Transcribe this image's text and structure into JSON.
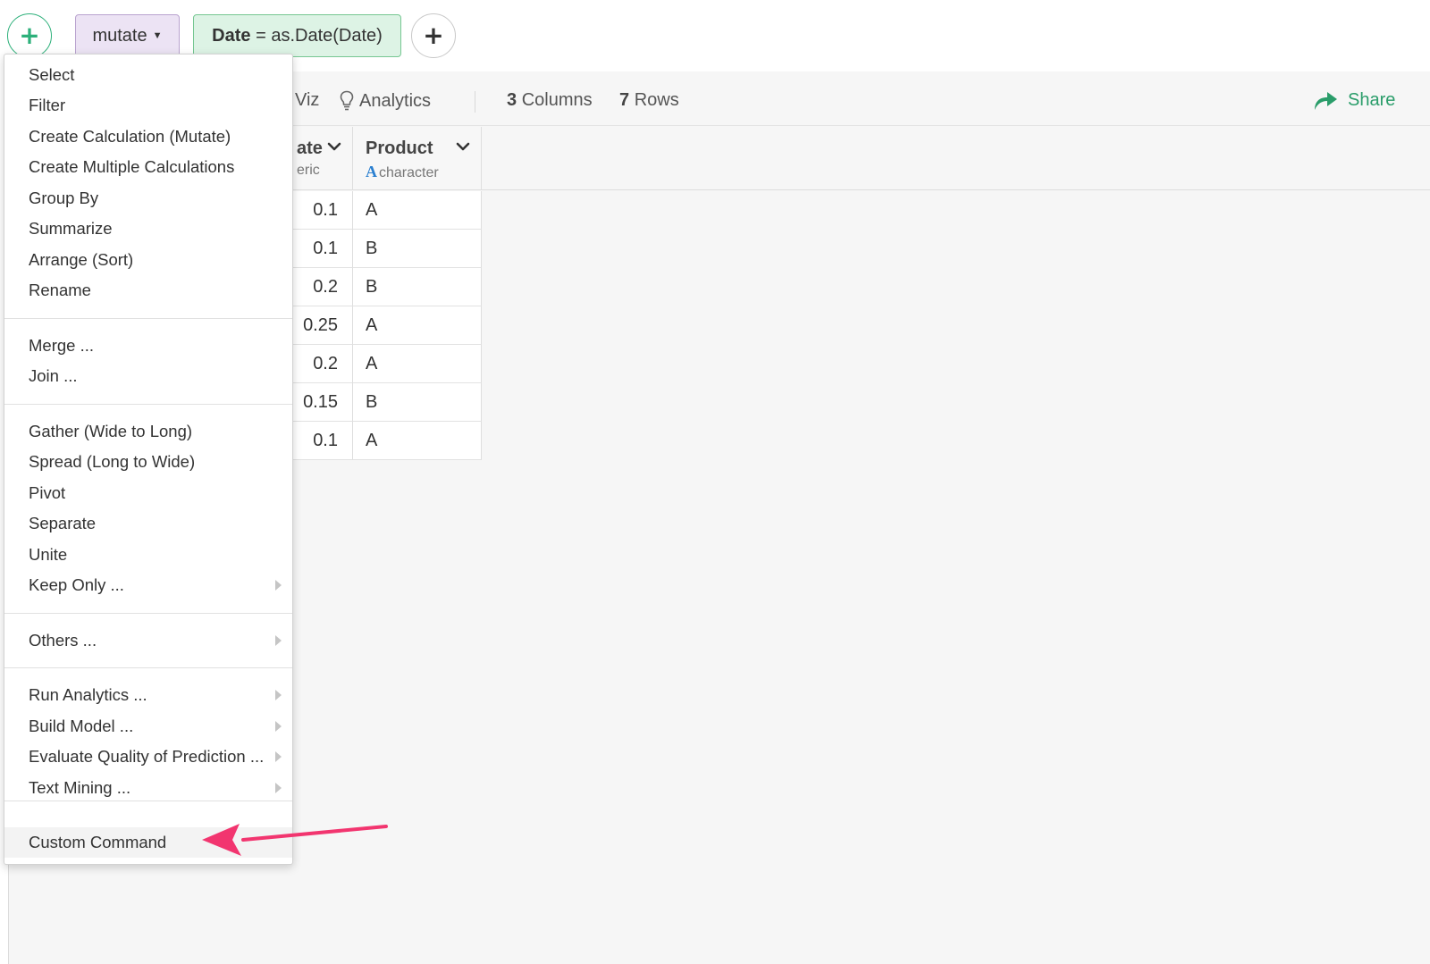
{
  "steps": {
    "command": "mutate",
    "expression_bold": "Date",
    "expression_rest": " = as.Date(Date)"
  },
  "toolbar": {
    "viz_label": "Viz",
    "analytics_label": "Analytics",
    "columns_count": "3",
    "columns_label": "Columns",
    "rows_count": "7",
    "rows_label": "Rows",
    "share_label": "Share"
  },
  "table": {
    "columns": [
      {
        "name": "ate",
        "type": "eric"
      },
      {
        "name": "Product",
        "type_icon": "A",
        "type": "character"
      }
    ],
    "rows": [
      [
        "0.1",
        "A"
      ],
      [
        "0.1",
        "B"
      ],
      [
        "0.2",
        "B"
      ],
      [
        "0.25",
        "A"
      ],
      [
        "0.2",
        "A"
      ],
      [
        "0.15",
        "B"
      ],
      [
        "0.1",
        "A"
      ]
    ]
  },
  "menu": {
    "items": [
      {
        "label": "Select"
      },
      {
        "label": "Filter"
      },
      {
        "label": "Create Calculation (Mutate)"
      },
      {
        "label": "Create Multiple Calculations"
      },
      {
        "label": "Group By"
      },
      {
        "label": "Summarize"
      },
      {
        "label": "Arrange (Sort)"
      },
      {
        "label": "Rename"
      },
      {
        "label": "Merge ..."
      },
      {
        "label": "Join ..."
      },
      {
        "label": "Gather (Wide to Long)"
      },
      {
        "label": "Spread (Long to Wide)"
      },
      {
        "label": "Pivot"
      },
      {
        "label": "Separate"
      },
      {
        "label": "Unite"
      },
      {
        "label": "Keep Only ...",
        "submenu": true
      },
      {
        "label": "Others ...",
        "submenu": true
      },
      {
        "label": "Run Analytics ...",
        "submenu": true
      },
      {
        "label": "Build Model ...",
        "submenu": true
      },
      {
        "label": "Evaluate Quality of Prediction ...",
        "submenu": true
      },
      {
        "label": "Text Mining ...",
        "submenu": true
      },
      {
        "label": "Custom Command",
        "highlighted": true
      }
    ]
  },
  "colors": {
    "accent_green": "#2db07a",
    "mutate_bg": "#ece3f4",
    "expression_bg": "#ddf3e5",
    "annotation_arrow": "#f2356f",
    "type_icon": "#2a7fd0"
  }
}
